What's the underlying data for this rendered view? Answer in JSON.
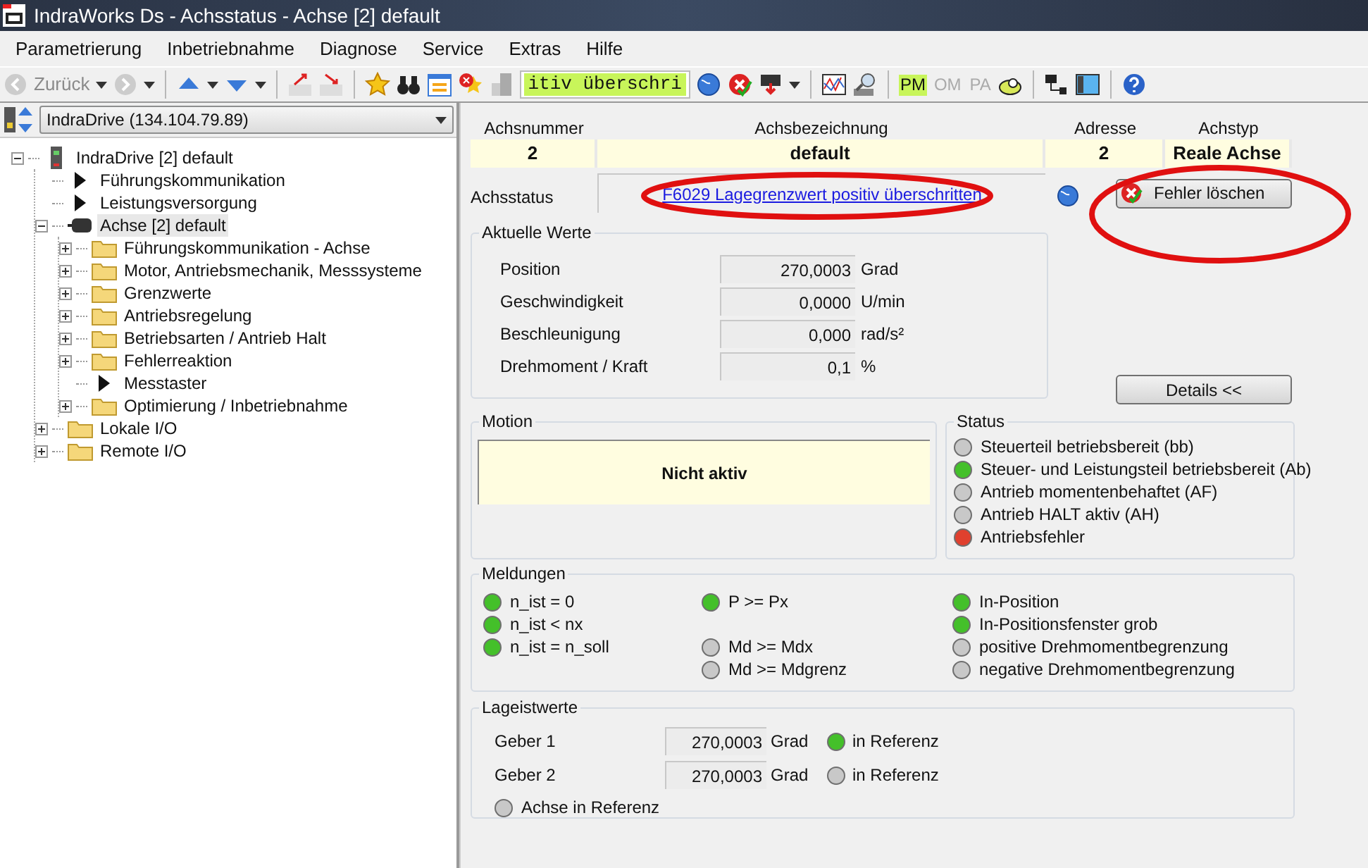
{
  "window": {
    "title": "IndraWorks Ds - Achsstatus - Achse [2] default"
  },
  "menu": [
    "Parametrierung",
    "Inbetriebnahme",
    "Diagnose",
    "Service",
    "Extras",
    "Hilfe"
  ],
  "toolbar": {
    "back_label": "Zurück",
    "search_value": "itiv überschri",
    "mode_buttons": [
      {
        "label": "PM",
        "selected": true
      },
      {
        "label": "OM",
        "selected": false
      },
      {
        "label": "PA",
        "selected": false
      }
    ]
  },
  "device_selector": {
    "value": "IndraDrive (134.104.79.89)"
  },
  "tree": [
    {
      "label": "IndraDrive [2] default",
      "kind": "device",
      "expanded": true,
      "selected": false,
      "children": [
        {
          "label": "Führungskommunikation",
          "kind": "leaf",
          "selected": false
        },
        {
          "label": "Leistungsversorgung",
          "kind": "leaf",
          "selected": false
        },
        {
          "label": "Achse [2] default",
          "kind": "axis",
          "expanded": true,
          "selected": true,
          "children": [
            {
              "label": "Führungskommunikation - Achse",
              "kind": "folder",
              "expanded": false,
              "selected": false
            },
            {
              "label": "Motor, Antriebsmechanik, Messsysteme",
              "kind": "folder",
              "expanded": false,
              "selected": false
            },
            {
              "label": "Grenzwerte",
              "kind": "folder",
              "expanded": false,
              "selected": false
            },
            {
              "label": "Antriebsregelung",
              "kind": "folder",
              "expanded": false,
              "selected": false
            },
            {
              "label": "Betriebsarten / Antrieb Halt",
              "kind": "folder",
              "expanded": false,
              "selected": false
            },
            {
              "label": "Fehlerreaktion",
              "kind": "folder",
              "expanded": false,
              "selected": false
            },
            {
              "label": "Messtaster",
              "kind": "leaf",
              "selected": false
            },
            {
              "label": "Optimierung / Inbetriebnahme",
              "kind": "folder",
              "expanded": false,
              "selected": false
            }
          ]
        },
        {
          "label": "Lokale I/O",
          "kind": "folder",
          "expanded": false,
          "selected": false
        },
        {
          "label": "Remote I/O",
          "kind": "folder",
          "expanded": false,
          "selected": false
        }
      ]
    }
  ],
  "axis_table": {
    "columns": [
      "Achsnummer",
      "Achsbezeichnung",
      "Adresse",
      "Achstyp"
    ],
    "row": [
      "2",
      "default",
      "2",
      "Reale Achse"
    ]
  },
  "axis_status": {
    "label": "Achsstatus",
    "message": "F6029 Lagegrenzwert positiv überschritten",
    "clear_button": "Fehler löschen"
  },
  "current_values": {
    "title": "Aktuelle Werte",
    "rows": [
      {
        "label": "Position",
        "value": "270,0003",
        "unit": "Grad"
      },
      {
        "label": "Geschwindigkeit",
        "value": "0,0000",
        "unit": "U/min"
      },
      {
        "label": "Beschleunigung",
        "value": "0,000",
        "unit": "rad/s²"
      },
      {
        "label": "Drehmoment / Kraft",
        "value": "0,1",
        "unit": "%"
      }
    ]
  },
  "details_button": "Details <<",
  "motion": {
    "title": "Motion",
    "state": "Nicht aktiv"
  },
  "status": {
    "title": "Status",
    "items": [
      {
        "label": "Steuerteil betriebsbereit (bb)",
        "color": "#c8c8c8"
      },
      {
        "label": "Steuer- und Leistungsteil betriebsbereit (Ab)",
        "color": "#44c02a"
      },
      {
        "label": "Antrieb momentenbehaftet (AF)",
        "color": "#c8c8c8"
      },
      {
        "label": "Antrieb HALT aktiv (AH)",
        "color": "#c8c8c8"
      },
      {
        "label": "Antriebsfehler",
        "color": "#e0402e"
      }
    ]
  },
  "messages": {
    "title": "Meldungen",
    "rows": [
      [
        {
          "label": "n_ist = 0",
          "color": "#44c02a"
        },
        {
          "label": "P >= Px",
          "color": "#44c02a"
        },
        {
          "label": "In-Position",
          "color": "#44c02a"
        }
      ],
      [
        {
          "label": "n_ist < nx",
          "color": "#44c02a"
        },
        null,
        {
          "label": "In-Positionsfenster grob",
          "color": "#44c02a"
        }
      ],
      [
        {
          "label": "n_ist = n_soll",
          "color": "#44c02a"
        },
        {
          "label": "Md >= Mdx",
          "color": "#c8c8c8"
        },
        {
          "label": "positive Drehmomentbegrenzung",
          "color": "#c8c8c8"
        }
      ],
      [
        null,
        {
          "label": "Md >= Mdgrenz",
          "color": "#c8c8c8"
        },
        {
          "label": "negative Drehmomentbegrenzung",
          "color": "#c8c8c8"
        }
      ]
    ]
  },
  "position_values": {
    "title": "Lageistwerte",
    "rows": [
      {
        "label": "Geber 1",
        "value": "270,0003",
        "unit": "Grad",
        "indicator": {
          "label": "in Referenz",
          "color": "#44c02a"
        }
      },
      {
        "label": "Geber 2",
        "value": "270,0003",
        "unit": "Grad",
        "indicator": {
          "label": "in Referenz",
          "color": "#c8c8c8"
        }
      }
    ],
    "axis_reference": {
      "label": "Achse in Referenz",
      "color": "#c8c8c8"
    }
  }
}
